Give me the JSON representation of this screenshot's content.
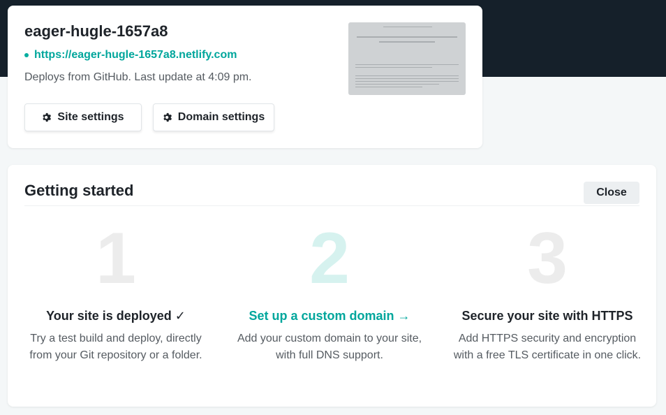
{
  "site": {
    "name": "eager-hugle-1657a8",
    "url": "https://eager-hugle-1657a8.netlify.com",
    "meta": "Deploys from GitHub. Last update at 4:09 pm.",
    "buttons": {
      "site_settings": "Site settings",
      "domain_settings": "Domain settings"
    }
  },
  "getting_started": {
    "title": "Getting started",
    "close_label": "Close",
    "steps": [
      {
        "number": "1",
        "title": "Your site is deployed ✓",
        "description": "Try a test build and deploy, directly from your Git repository or a folder."
      },
      {
        "number": "2",
        "title": "Set up a custom domain →",
        "description": "Add your custom domain to your site, with full DNS support."
      },
      {
        "number": "3",
        "title": "Secure your site with HTTPS",
        "description": "Add HTTPS security and encryption with a free TLS certificate in one click."
      }
    ]
  },
  "colors": {
    "header_band": "#15202a",
    "accent": "#00a69c",
    "page_bg": "#f4f7f8"
  },
  "icons": {
    "settings": "gear-icon",
    "status": "status-dot-icon"
  }
}
